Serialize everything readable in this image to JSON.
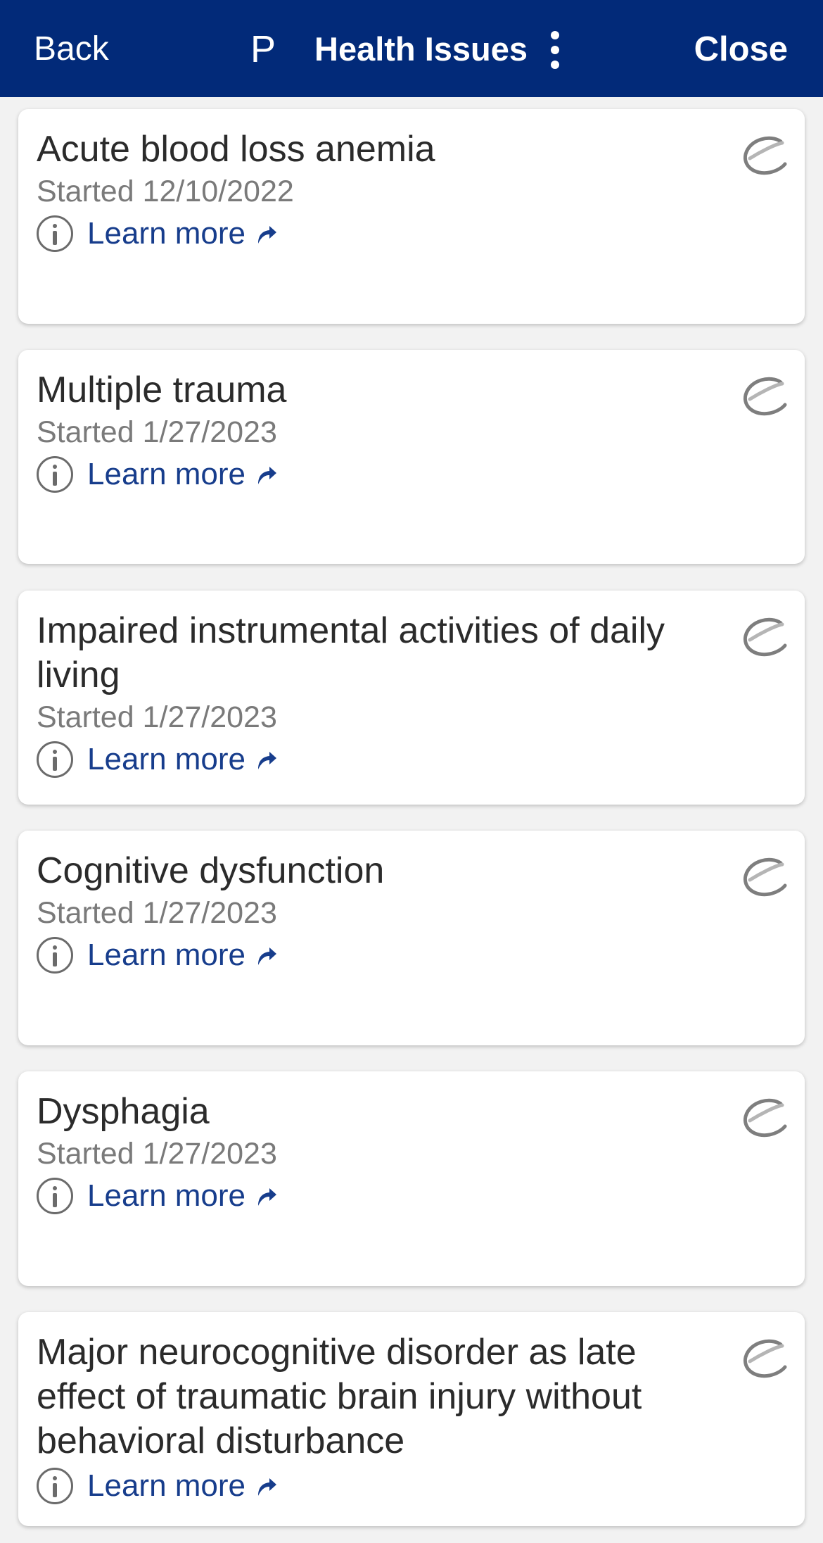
{
  "header": {
    "back_label": "Back",
    "avatar_initial": "P",
    "title": "Health Issues",
    "close_label": "Close",
    "background_color": "#022a79"
  },
  "icons": {
    "more": "more-vertical-icon",
    "info": "info-circle-icon",
    "external": "external-link-icon",
    "source": "source-logo-icon"
  },
  "issues": [
    {
      "title": "Acute blood loss anemia",
      "started": "Started 12/10/2022",
      "learn_more": "Learn more"
    },
    {
      "title": "Multiple trauma",
      "started": "Started 1/27/2023",
      "learn_more": "Learn more"
    },
    {
      "title": "Impaired instrumental activities of daily living",
      "started": "Started 1/27/2023",
      "learn_more": "Learn more"
    },
    {
      "title": "Cognitive dysfunction",
      "started": "Started 1/27/2023",
      "learn_more": "Learn more"
    },
    {
      "title": "Dysphagia",
      "started": "Started 1/27/2023",
      "learn_more": "Learn more"
    },
    {
      "title": "Major neurocognitive disorder as late effect of traumatic brain injury without behavioral disturbance",
      "started": "",
      "learn_more": "Learn more"
    }
  ]
}
